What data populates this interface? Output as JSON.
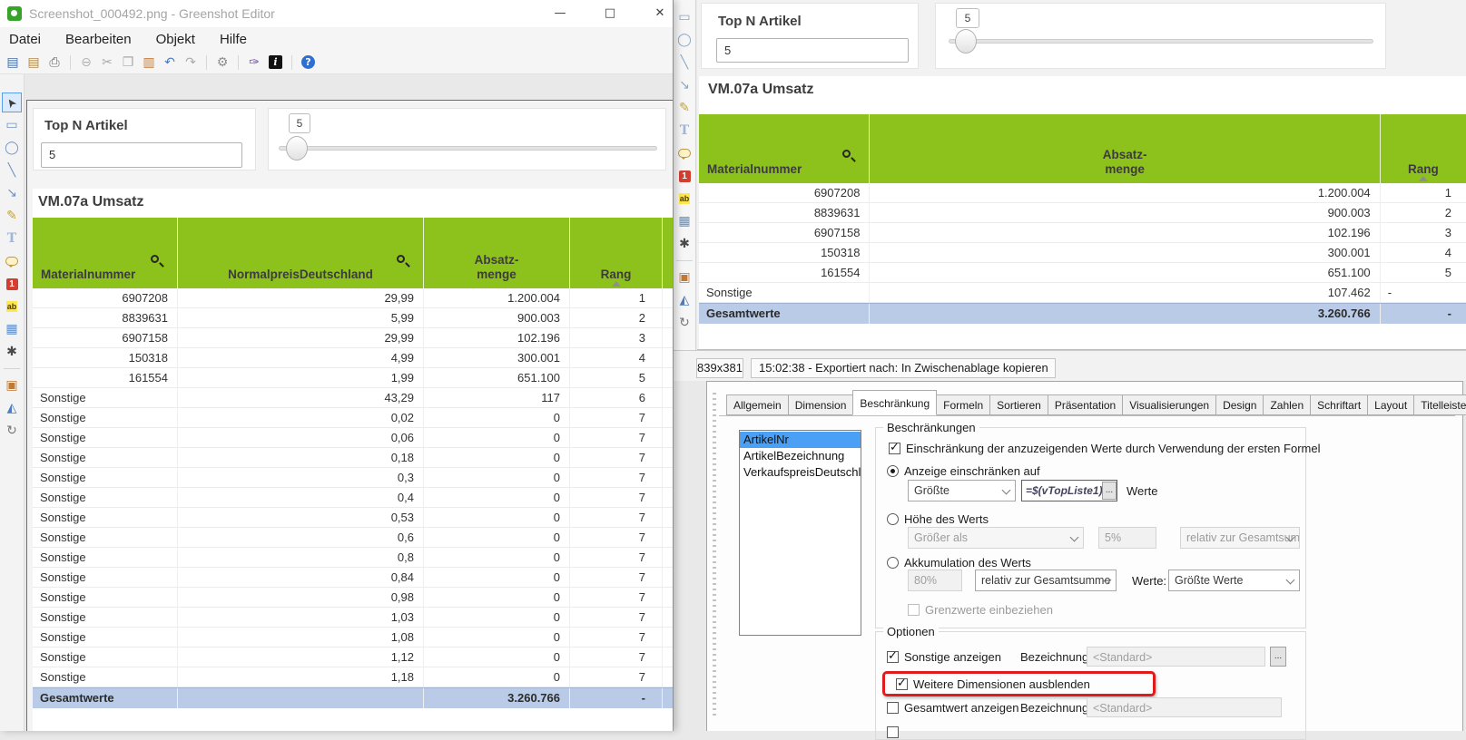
{
  "colors": {
    "table_header_green": "#8dc21d",
    "total_row_blue": "#b9cbe6",
    "highlight_red": "#de1c1c",
    "selection_blue": "#4aa0f5",
    "help_blue": "#2e6fd0"
  },
  "front_window": {
    "title": "Screenshot_000492.png - Greenshot Editor",
    "window_controls": {
      "minimize": "—",
      "maximize": "□",
      "close": "✕"
    },
    "menu": [
      "Datei",
      "Bearbeiten",
      "Objekt",
      "Hilfe"
    ],
    "toolbar": [
      {
        "name": "save-icon",
        "glyph": "▤",
        "color": "#4a6fa5"
      },
      {
        "name": "paste-clipboard-icon",
        "glyph": "▤",
        "color": "#b08a4e"
      },
      {
        "name": "print-icon",
        "glyph": "⎙",
        "color": "#666666"
      },
      {
        "sep": true
      },
      {
        "name": "remove-icon",
        "glyph": "⊖",
        "color": "#b3b3b3"
      },
      {
        "name": "cut-icon",
        "glyph": "✂",
        "color": "#a8a8a8"
      },
      {
        "name": "copy-icon",
        "glyph": "❐",
        "color": "#a8a8a8"
      },
      {
        "name": "paste-icon",
        "glyph": "▥",
        "color": "#c07a35"
      },
      {
        "name": "undo-icon",
        "glyph": "↶",
        "color": "#4a79c4"
      },
      {
        "name": "redo-icon",
        "glyph": "↷",
        "color": "#ababab"
      },
      {
        "sep": true
      },
      {
        "name": "settings-gear-icon",
        "glyph": "⚙",
        "color": "#8c8c8c"
      },
      {
        "sep": true
      },
      {
        "name": "effects-brush-icon",
        "glyph": "✑",
        "color": "#7a52a8"
      },
      {
        "name": "info-icon",
        "glyph": "i",
        "kind": "info"
      },
      {
        "sep": true
      },
      {
        "name": "help-icon",
        "glyph": "?",
        "kind": "help"
      }
    ],
    "tools": [
      {
        "name": "selection-cursor-tool",
        "glyph": "➤",
        "kind": "cursor",
        "selected": true
      },
      {
        "name": "rectangle-tool",
        "glyph": "▭",
        "color": "#7193c1"
      },
      {
        "name": "ellipse-tool",
        "glyph": "◯",
        "color": "#7193c1"
      },
      {
        "name": "line-tool",
        "glyph": "╲",
        "color": "#7193c1"
      },
      {
        "name": "arrow-tool",
        "glyph": "↘",
        "color": "#7193c1"
      },
      {
        "name": "freehand-tool",
        "glyph": "✎",
        "color": "#c9a227"
      },
      {
        "name": "text-tool",
        "glyph": "T",
        "kind": "text"
      },
      {
        "name": "speechbubble-tool",
        "glyph": "",
        "kind": "bubble"
      },
      {
        "name": "counter-tool",
        "glyph": "1",
        "kind": "counter"
      },
      {
        "name": "highlight-tool",
        "glyph": "ab",
        "kind": "highlight"
      },
      {
        "name": "obfuscate-tool",
        "glyph": "▦",
        "color": "#5e8fc9"
      },
      {
        "name": "effects-tool",
        "glyph": "✱",
        "color": "#4a4a4a"
      },
      {
        "sep": true
      },
      {
        "name": "crop-tool",
        "glyph": "▣",
        "color": "#c07a35"
      },
      {
        "name": "flip-tool",
        "glyph": "◭",
        "color": "#4f7bbf"
      },
      {
        "name": "rotate-tool",
        "glyph": "↻",
        "color": "#777777"
      }
    ],
    "sheet": {
      "filter_card": {
        "title": "Top N Artikel",
        "value": "5"
      },
      "slider_card": {
        "value": "5"
      },
      "table_title": "VM.07a Umsatz",
      "table": {
        "columns": [
          {
            "label": "Materialnummer",
            "search": true
          },
          {
            "label": "NormalpreisDeutschland",
            "search": true
          },
          {
            "label": "Absatz-\nmenge"
          },
          {
            "label": "Rang",
            "sort": true
          },
          {
            "label": ""
          }
        ],
        "rows": [
          [
            "6907208",
            "29,99",
            "1.200.004",
            "1",
            ""
          ],
          [
            "8839631",
            "5,99",
            "900.003",
            "2",
            ""
          ],
          [
            "6907158",
            "29,99",
            "102.196",
            "3",
            ""
          ],
          [
            "150318",
            "4,99",
            "300.001",
            "4",
            ""
          ],
          [
            "161554",
            "1,99",
            "651.100",
            "5",
            ""
          ],
          [
            "Sonstige",
            "43,29",
            "117",
            "6",
            ""
          ],
          [
            "Sonstige",
            "0,02",
            "0",
            "7",
            ""
          ],
          [
            "Sonstige",
            "0,06",
            "0",
            "7",
            ""
          ],
          [
            "Sonstige",
            "0,18",
            "0",
            "7",
            ""
          ],
          [
            "Sonstige",
            "0,3",
            "0",
            "7",
            ""
          ],
          [
            "Sonstige",
            "0,4",
            "0",
            "7",
            ""
          ],
          [
            "Sonstige",
            "0,53",
            "0",
            "7",
            ""
          ],
          [
            "Sonstige",
            "0,6",
            "0",
            "7",
            ""
          ],
          [
            "Sonstige",
            "0,8",
            "0",
            "7",
            ""
          ],
          [
            "Sonstige",
            "0,84",
            "0",
            "7",
            ""
          ],
          [
            "Sonstige",
            "0,98",
            "0",
            "7",
            ""
          ],
          [
            "Sonstige",
            "1,03",
            "0",
            "7",
            ""
          ],
          [
            "Sonstige",
            "1,08",
            "0",
            "7",
            ""
          ],
          [
            "Sonstige",
            "1,12",
            "0",
            "7",
            ""
          ],
          [
            "Sonstige",
            "1,18",
            "0",
            "7",
            ""
          ]
        ],
        "total": [
          "Gesamtwerte",
          "",
          "3.260.766",
          "-",
          ""
        ]
      }
    }
  },
  "back_window": {
    "tools": [
      {
        "name": "rectangle-tool",
        "glyph": "▭",
        "color": "#8aa5c9"
      },
      {
        "name": "ellipse-tool",
        "glyph": "◯",
        "color": "#8aa5c9"
      },
      {
        "name": "line-tool",
        "glyph": "╲",
        "color": "#8aa5c9"
      },
      {
        "name": "arrow-tool",
        "glyph": "↘",
        "color": "#8aa5c9"
      },
      {
        "name": "freehand-tool",
        "glyph": "✎",
        "color": "#c9a227"
      },
      {
        "name": "text-tool",
        "glyph": "T",
        "kind": "text"
      },
      {
        "name": "speechbubble-tool",
        "glyph": "",
        "kind": "bubble"
      },
      {
        "name": "counter-tool",
        "glyph": "1",
        "kind": "counter"
      },
      {
        "name": "highlight-tool",
        "glyph": "ab",
        "kind": "highlight"
      },
      {
        "name": "obfuscate-tool",
        "glyph": "▦",
        "color": "#5e8fc9"
      },
      {
        "name": "effects-tool",
        "glyph": "✱",
        "color": "#4a4a4a"
      },
      {
        "sep": true
      },
      {
        "name": "crop-tool",
        "glyph": "▣",
        "color": "#c07a35"
      },
      {
        "name": "flip-tool",
        "glyph": "◭",
        "color": "#4f7bbf"
      },
      {
        "name": "rotate-tool",
        "glyph": "↻",
        "color": "#777777"
      }
    ],
    "sheet": {
      "filter_card": {
        "title": "Top N Artikel",
        "value": "5"
      },
      "slider_card": {
        "value": "5"
      },
      "table_title": "VM.07a Umsatz",
      "table": {
        "columns": [
          {
            "label": "Materialnummer",
            "search": true
          },
          {
            "label": "Absatz-\nmenge"
          },
          {
            "label": "Rang",
            "sort": true
          }
        ],
        "rows": [
          [
            "6907208",
            "1.200.004",
            "1"
          ],
          [
            "8839631",
            "900.003",
            "2"
          ],
          [
            "6907158",
            "102.196",
            "3"
          ],
          [
            "150318",
            "300.001",
            "4"
          ],
          [
            "161554",
            "651.100",
            "5"
          ],
          [
            "Sonstige",
            "107.462",
            "-"
          ]
        ],
        "total": [
          "Gesamtwerte",
          "3.260.766",
          "-"
        ]
      }
    },
    "statusbar": {
      "dimensions": "839x381",
      "message": "15:02:38 - Exportiert nach: In Zwischenablage kopieren"
    }
  },
  "dialog": {
    "tabs": [
      "Allgemein",
      "Dimension",
      "Beschränkung",
      "Formeln",
      "Sortieren",
      "Präsentation",
      "Visualisierungen",
      "Design",
      "Zahlen",
      "Schriftart",
      "Layout",
      "Titelleiste"
    ],
    "active_tab": "Beschränkung",
    "dimensions_list": {
      "items": [
        "ArtikelNr",
        "ArtikelBezeichnung",
        "VerkaufspreisDeutschland"
      ],
      "selected": "ArtikelNr"
    },
    "restrictions": {
      "group_title": "Beschränkungen",
      "first_formula_label": "Einschränkung der anzuzeigenden Werte durch Verwendung der ersten Formel",
      "first_formula_checked": true,
      "show_option": {
        "label": "Anzeige einschränken auf",
        "selected": true,
        "mode": "Größte",
        "formula": "=$(vTopListe1)",
        "ellipsis": "...",
        "suffix": "Werte"
      },
      "value_option": {
        "label": "Höhe des Werts",
        "selected": false,
        "mode": "Größer als",
        "value": "5%",
        "relative": "relativ zur Gesamtsumn"
      },
      "accumulate_option": {
        "label": "Akkumulation des Werts",
        "selected": false,
        "value": "80%",
        "relative": "relativ zur Gesamtsumme",
        "werte_label": "Werte:",
        "mode": "Größte Werte"
      },
      "include_boundaries": {
        "label": "Grenzwerte einbeziehen",
        "checked": false
      }
    },
    "options": {
      "group_title": "Optionen",
      "show_others": {
        "label": "Sonstige anzeigen",
        "checked": true
      },
      "label_caption": "Bezeichnung:",
      "others_caption": "<Standard>",
      "others_ellipsis": "...",
      "hide_dimensions": {
        "label": "Weitere Dimensionen ausblenden",
        "checked": true,
        "highlighted": true
      },
      "show_total": {
        "label": "Gesamtwert anzeigen",
        "checked": false
      },
      "total_caption": "<Standard>"
    }
  }
}
